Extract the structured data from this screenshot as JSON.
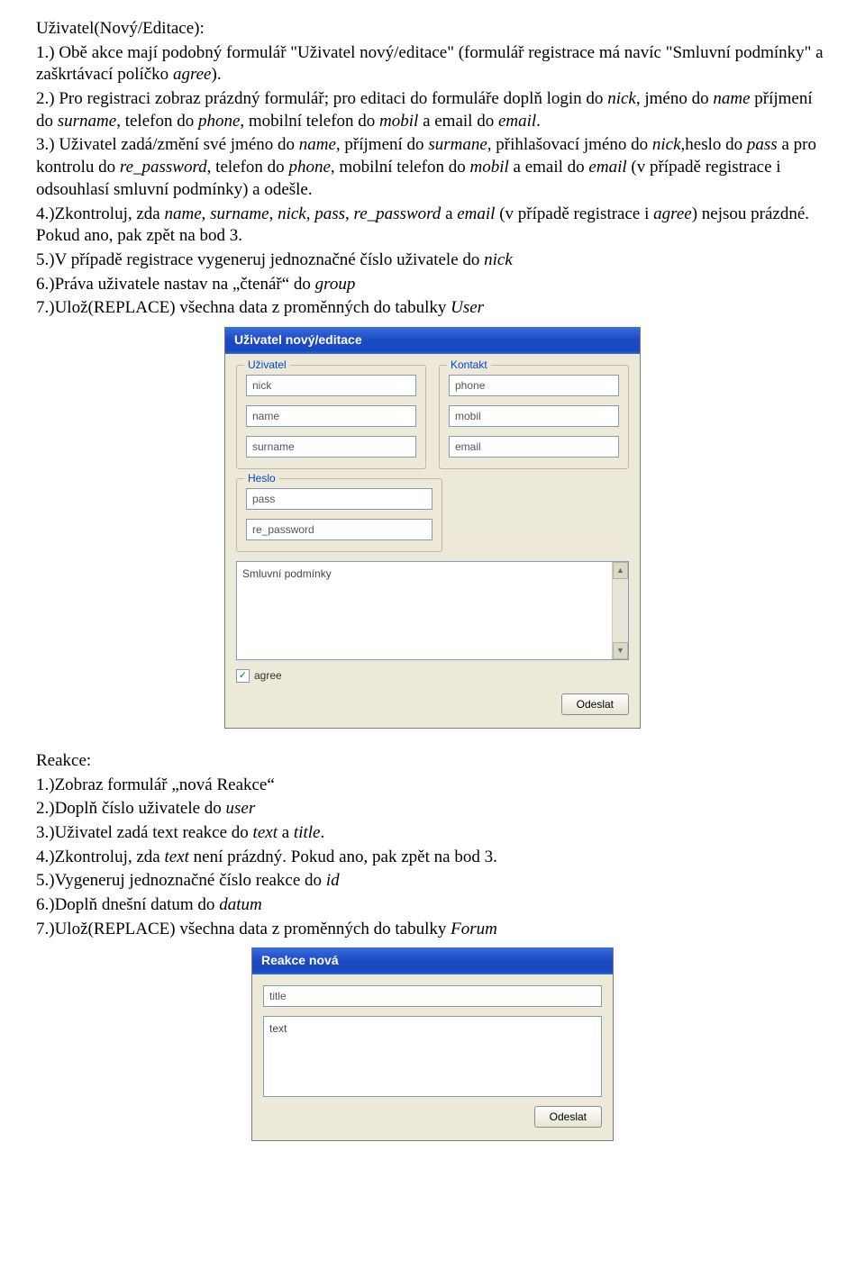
{
  "section1": {
    "heading": "Uživatel(Nový/Editace):",
    "l1a": "1.) Obě akce mají podobný formulář \"Uživatel nový/editace\" (formulář registrace má navíc \"Smluvní podmínky\" a zaškrtávací políčko ",
    "l1b": "agree",
    "l1c": ").",
    "l2a": "2.) Pro registraci zobraz prázdný formulář; pro editaci do formuláře doplň login do ",
    "nick": "nick",
    "l2b": ", jméno do ",
    "name": "name",
    "l2c": " příjmení do ",
    "surname": "surname",
    "l2d": ", telefon do ",
    "phone": "phone",
    "l2e": ", mobilní telefon do ",
    "mobil": "mobil",
    "l2f": " a email do ",
    "email": "email",
    "l2g": ".",
    "l3a": "3.) Uživatel zadá/změní své jméno do ",
    "l3b": ", příjmení do ",
    "surmane": "surmane",
    "l3c": ", přihlašovací jméno do ",
    "l3d": ",heslo do ",
    "pass": "pass",
    "l3e": " a pro kontrolu do ",
    "repass": "re_password",
    "l3f": ", telefon do ",
    "l3g": ", mobilní telefon do ",
    "l3h": " a email do ",
    "l3i": " (v případě registrace i odsouhlasí smluvní podmínky) a odešle.",
    "l4a": "4.)Zkontroluj, zda ",
    "l4b": ", ",
    "l4c": ", ",
    "l4d": ", ",
    "l4e": ", ",
    "l4f": " a ",
    "l4g": " (v případě registrace i ",
    "l4h": ") nejsou prázdné. Pokud ano, pak zpět na bod 3.",
    "l5a": "5.)V případě registrace vygeneruj jednoznačné číslo uživatele do ",
    "l6a": "6.)Práva uživatele nastav na „čtenář“ do ",
    "group": "group",
    "l7a": "7.)Ulož(REPLACE) všechna data z proměnných do tabulky ",
    "user_tbl": "User"
  },
  "form1": {
    "title": "Uživatel nový/editace",
    "g1": "Uživatel",
    "g2": "Kontakt",
    "g3": "Heslo",
    "nick": "nick",
    "name": "name",
    "surname": "surname",
    "phone": "phone",
    "mobil": "mobil",
    "email": "email",
    "pass": "pass",
    "repass": "re_password",
    "tarea": "Smluvní podmínky",
    "agree": "agree",
    "submit": "Odeslat",
    "up": "▲",
    "down": "▼",
    "check": "✓"
  },
  "section2": {
    "heading": "Reakce:",
    "l1": "1.)Zobraz formulář „nová Reakce“",
    "l2a": "2.)Doplň číslo uživatele do ",
    "user": "user",
    "l3a": "3.)Uživatel zadá text reakce do ",
    "text": "text",
    "l3b": " a ",
    "title": "title",
    "l4a": "4.)Zkontroluj, zda ",
    "l4b": " není prázdný. Pokud ano, pak zpět na bod 3.",
    "l5a": "5.)Vygeneruj jednoznačné číslo reakce do ",
    "id": "id",
    "l6a": "6.)Doplň dnešní datum do ",
    "datum": "datum",
    "l7a": "7.)Ulož(REPLACE) všechna data z proměnných do tabulky ",
    "forum": "Forum",
    "period": "."
  },
  "form2": {
    "title": "Reakce nová",
    "f_title": "title",
    "f_text": "text",
    "submit": "Odeslat"
  }
}
